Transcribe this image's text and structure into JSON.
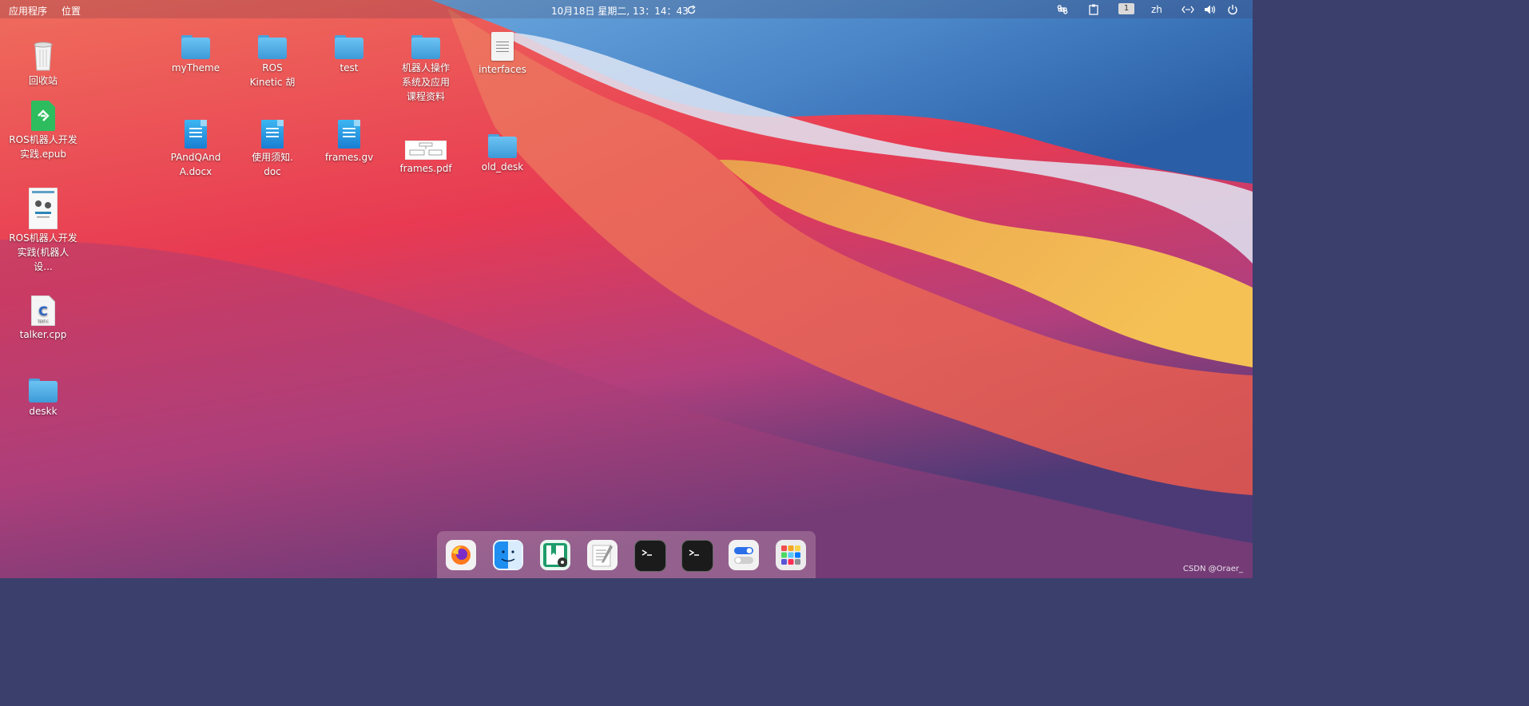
{
  "topbar": {
    "apps_menu": "应用程序",
    "places_menu": "位置",
    "datetime": "10月18日 星期二, 13：14：43",
    "workspace": "1",
    "language": "zh",
    "icons": [
      "refresh-icon",
      "command-icon",
      "clipboard-icon",
      "network-icon",
      "volume-icon",
      "power-icon"
    ]
  },
  "desktop": {
    "trash": "回收站",
    "epub": "ROS机器人开发实践.epub",
    "book": "ROS机器人开发实践(机器人设...",
    "cpp": "talker.cpp",
    "deskk": "deskk",
    "mytheme": "myTheme",
    "ros_kinetic": "ROS Kinetic 胡",
    "test": "test",
    "course": "机器人操作系统及应用课程资料",
    "interfaces": "interfaces",
    "pandq": "PAndQAndA.docx",
    "notice": "使用须知.doc",
    "frames_gv": "frames.gv",
    "frames_pdf": "frames.pdf",
    "old_desk": "old_desk"
  },
  "dock": {
    "apps": [
      "firefox-icon",
      "finder-icon",
      "reader-icon",
      "text-editor-icon",
      "terminal-icon",
      "terminal-icon",
      "settings-toggle-icon",
      "app-grid-icon"
    ]
  },
  "watermark": "CSDN @Oraer_",
  "colors": {
    "topbar_text": "#ffffff",
    "folder": "#4aa2dc",
    "doc": "#1a7ed2"
  }
}
